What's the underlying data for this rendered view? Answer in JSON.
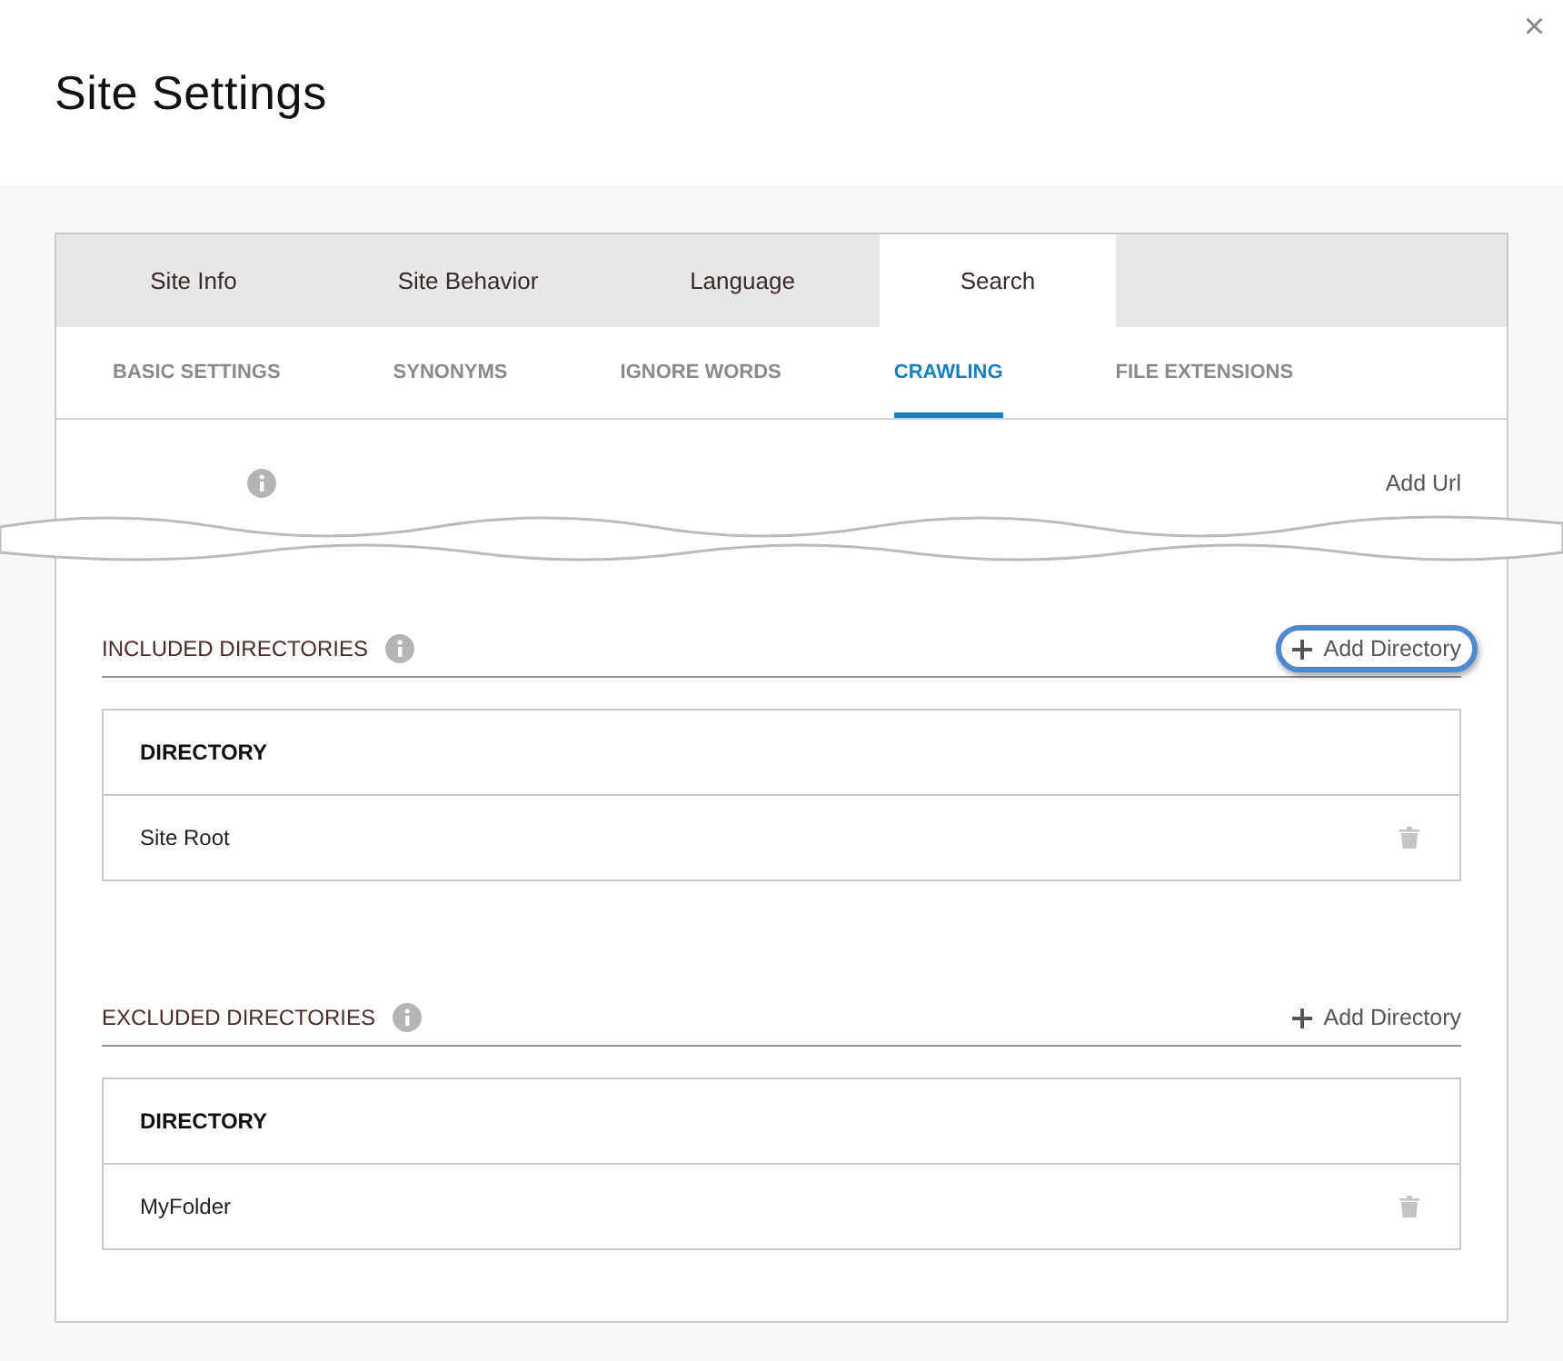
{
  "dialog": {
    "title": "Site Settings",
    "close": "×"
  },
  "tabs": [
    {
      "label": "Site Info",
      "selected": false
    },
    {
      "label": "Site Behavior",
      "selected": false
    },
    {
      "label": "Language",
      "selected": false
    },
    {
      "label": "Search",
      "selected": true
    }
  ],
  "subtabs": [
    {
      "label": "BASIC SETTINGS",
      "selected": false
    },
    {
      "label": "SYNONYMS",
      "selected": false
    },
    {
      "label": "IGNORE WORDS",
      "selected": false
    },
    {
      "label": "CRAWLING",
      "selected": true
    },
    {
      "label": "FILE EXTENSIONS",
      "selected": false
    }
  ],
  "cut_section": {
    "add_button": "Add Url"
  },
  "sections": [
    {
      "title": "INCLUDED DIRECTORIES",
      "add_button": {
        "label": "Add Directory",
        "focused": true
      },
      "table": {
        "column": "DIRECTORY",
        "rows": [
          {
            "directory": "Site Root"
          }
        ]
      }
    },
    {
      "title": "EXCLUDED DIRECTORIES",
      "add_button": {
        "label": "Add Directory",
        "focused": false
      },
      "table": {
        "column": "DIRECTORY",
        "rows": [
          {
            "directory": "MyFolder"
          }
        ]
      }
    }
  ]
}
